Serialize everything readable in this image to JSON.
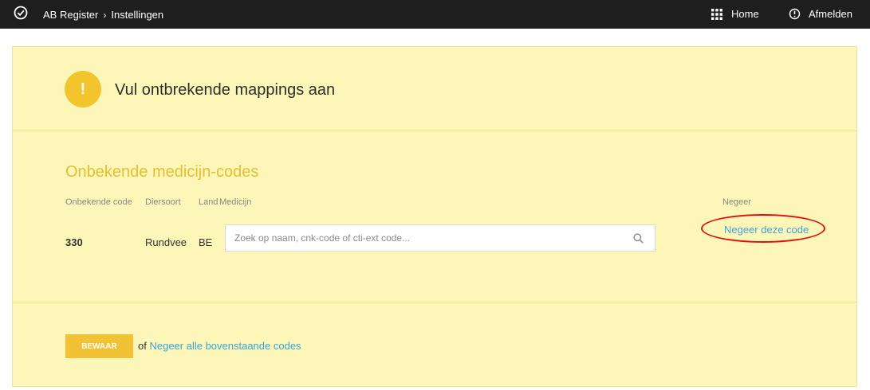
{
  "topbar": {
    "crumb_app": "AB Register",
    "crumb_separator": "›",
    "crumb_page": "Instellingen",
    "home_label": "Home",
    "logout_label": "Afmelden"
  },
  "alert": {
    "icon_char": "!",
    "title": "Vul ontbrekende mappings aan"
  },
  "unknown_codes": {
    "heading": "Onbekende medicijn-codes",
    "columns": {
      "code": "Onbekende code",
      "species": "Diersoort",
      "country": "Land",
      "medicine": "Medicijn",
      "ignore": "Negeer"
    },
    "rows": [
      {
        "code": "330",
        "species": "Rundvee",
        "country": "BE",
        "search_placeholder": "Zoek op naam, cnk-code of cti-ext code...",
        "ignore_link": "Negeer deze code"
      }
    ]
  },
  "footer": {
    "save_label": "BEWAAR",
    "or_text": "of",
    "ignore_all_link": "Negeer alle bovenstaande codes"
  },
  "colors": {
    "topbar": "#1e1e1e",
    "panel": "#fdf6b9",
    "accent": "#f1c233",
    "link": "#3aa4da",
    "annotation": "#e01010"
  }
}
